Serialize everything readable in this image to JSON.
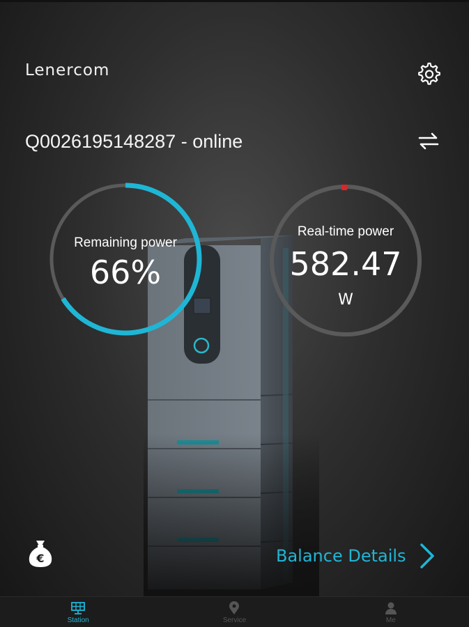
{
  "header": {
    "logo_text": "Lenercom",
    "settings_icon": "gear-icon"
  },
  "device": {
    "title": "Q0026195148287 - online",
    "switch_icon": "swap-arrows-icon"
  },
  "gauges": {
    "remaining": {
      "label": "Remaining power",
      "value": "66%",
      "fraction": 0.66,
      "color": "#1fb6d6"
    },
    "realtime": {
      "label": "Real-time power",
      "value": "582.47",
      "unit": "W",
      "indicator_color": "#d62828"
    }
  },
  "balance": {
    "icon": "money-bag-euro-icon",
    "label": "Balance Details",
    "chevron_icon": "chevron-right-icon"
  },
  "tabs": [
    {
      "label": "Station",
      "icon": "solar-panel-icon",
      "active": true
    },
    {
      "label": "Service",
      "icon": "location-pin-icon",
      "active": false
    },
    {
      "label": "Me",
      "icon": "person-icon",
      "active": false
    }
  ],
  "colors": {
    "accent": "#1fb6d6",
    "background": "#2e2e2e",
    "ring": "#5a5a5a"
  }
}
